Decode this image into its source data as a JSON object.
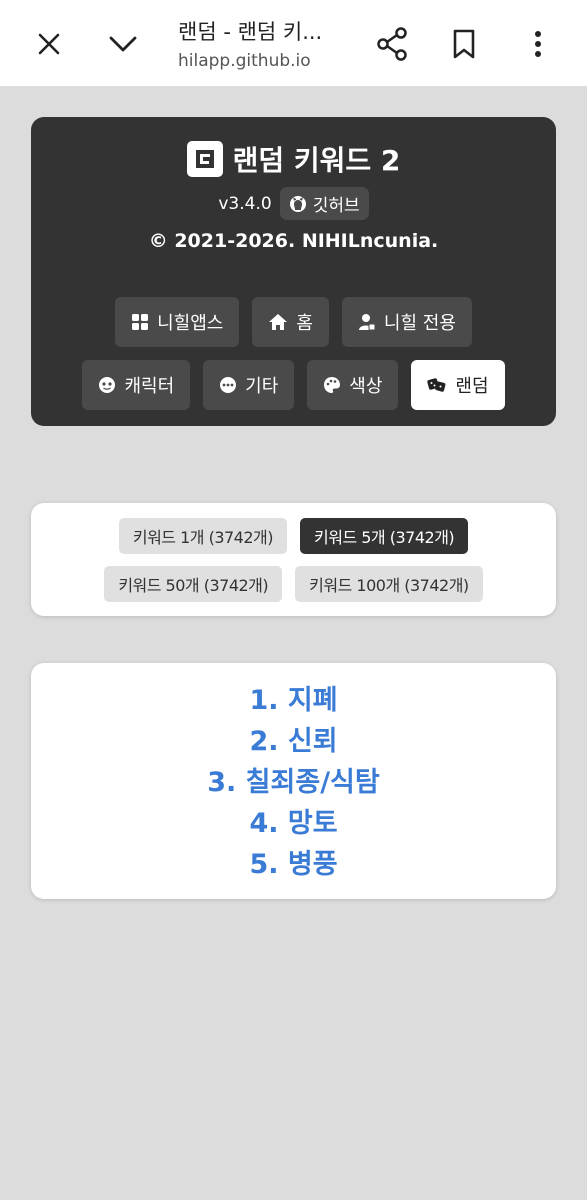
{
  "browser": {
    "title": "랜덤 - 랜덤 키...",
    "url": "hilapp.github.io"
  },
  "header": {
    "title": "랜덤 키워드 2",
    "version": "v3.4.0",
    "github_label": "깃허브",
    "copyright": "© 2021-2026. NIHILncunia.",
    "nav_row1": [
      {
        "label": "니힐앱스",
        "icon": "grid-icon"
      },
      {
        "label": "홈",
        "icon": "home-icon"
      },
      {
        "label": "니힐 전용",
        "icon": "user-icon"
      }
    ],
    "nav_row2": [
      {
        "label": "캐릭터",
        "icon": "face-icon"
      },
      {
        "label": "기타",
        "icon": "dots-icon"
      },
      {
        "label": "색상",
        "icon": "palette-icon"
      },
      {
        "label": "랜덤",
        "icon": "dice-icon",
        "active": true
      }
    ]
  },
  "options": {
    "row1": [
      {
        "label": "키워드 1개 (3742개)"
      },
      {
        "label": "키워드 5개 (3742개)",
        "active": true
      }
    ],
    "row2": [
      {
        "label": "키워드 50개 (3742개)"
      },
      {
        "label": "키워드 100개 (3742개)"
      }
    ]
  },
  "results": [
    "1. 지폐",
    "2. 신뢰",
    "3. 칠죄종/식탐",
    "4. 망토",
    "5. 병풍"
  ],
  "colors": {
    "accent": "#3a7bd5",
    "header_bg": "#333333",
    "page_bg": "#dcdcdc"
  }
}
